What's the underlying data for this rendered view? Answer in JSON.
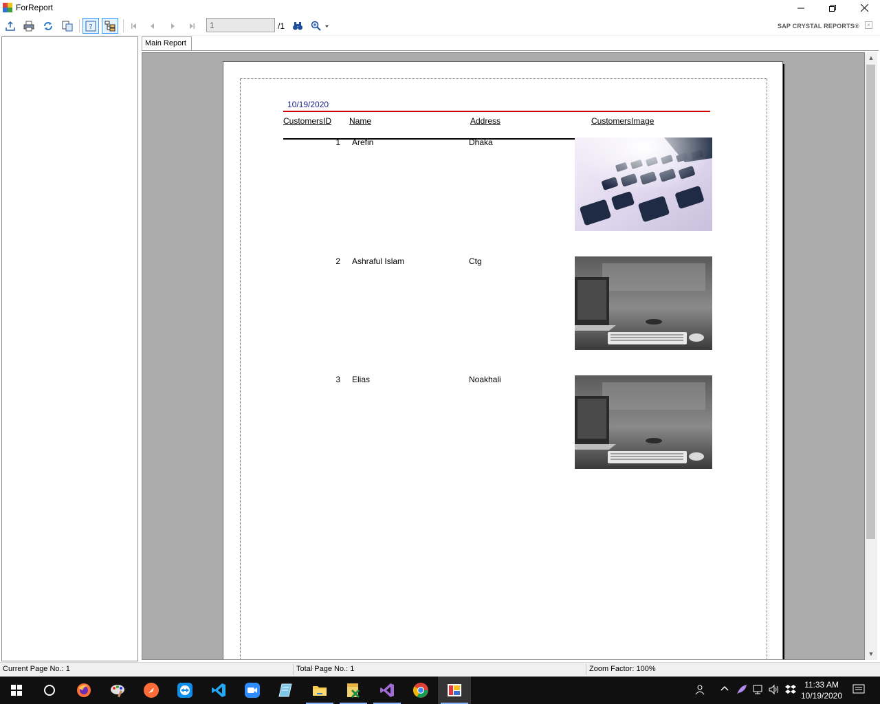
{
  "window": {
    "title": "ForReport"
  },
  "toolbar": {
    "page_value": "1",
    "page_total": "/1",
    "brand": "SAP CRYSTAL REPORTS®"
  },
  "tabs": [
    {
      "label": "Main Report"
    }
  ],
  "report": {
    "date": "10/19/2020",
    "headers": {
      "id": "CustomersID",
      "name": "Name",
      "address": "Address",
      "image": "CustomersImage"
    },
    "rows": [
      {
        "id": "1",
        "name": "Arefin",
        "address": "Dhaka",
        "image": "keyboard-closeup-photo"
      },
      {
        "id": "2",
        "name": "Ashraful Islam",
        "address": "Ctg",
        "image": "desk-laptop-keyboard-photo"
      },
      {
        "id": "3",
        "name": "Elias",
        "address": "Noakhali",
        "image": "desk-laptop-keyboard-photo"
      }
    ]
  },
  "status": {
    "current_page": "Current Page No.: 1",
    "total_page": "Total Page No.: 1",
    "zoom": "Zoom Factor: 100%"
  },
  "taskbar": {
    "time": "11:33 AM",
    "date": "10/19/2020",
    "apps": [
      "start-icon",
      "search-icon",
      "firefox-icon",
      "paint-icon",
      "postman-icon",
      "teamviewer-icon",
      "vscode-icon",
      "zoom-icon",
      "notepad-icon",
      "file-explorer-icon",
      "excel-tool-icon",
      "visual-studio-icon",
      "chrome-icon",
      "forreport-icon"
    ]
  }
}
